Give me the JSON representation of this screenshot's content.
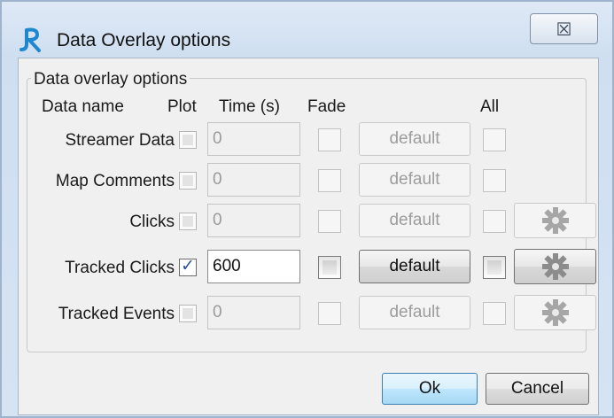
{
  "window": {
    "title": "Data Overlay options",
    "close_symbol": "☒",
    "app_icon": "app-logo-icon"
  },
  "group": {
    "label": "Data overlay options"
  },
  "headers": {
    "data_name": "Data name",
    "plot": "Plot",
    "time": "Time (s)",
    "fade": "Fade",
    "all": "All"
  },
  "rows": [
    {
      "name": "Streamer Data",
      "plot_checked": false,
      "enabled": false,
      "time": "0",
      "fade_checked": false,
      "default_label": "default",
      "all_checked": false,
      "has_settings": false
    },
    {
      "name": "Map Comments",
      "plot_checked": false,
      "enabled": false,
      "time": "0",
      "fade_checked": false,
      "default_label": "default",
      "all_checked": false,
      "has_settings": false
    },
    {
      "name": "Clicks",
      "plot_checked": false,
      "enabled": false,
      "time": "0",
      "fade_checked": false,
      "default_label": "default",
      "all_checked": false,
      "has_settings": true
    },
    {
      "name": "Tracked Clicks",
      "plot_checked": true,
      "enabled": true,
      "time": "600",
      "fade_checked": false,
      "default_label": "default",
      "all_checked": false,
      "has_settings": true
    },
    {
      "name": "Tracked Events",
      "plot_checked": false,
      "enabled": false,
      "time": "0",
      "fade_checked": false,
      "default_label": "default",
      "all_checked": false,
      "has_settings": true
    }
  ],
  "footer": {
    "ok_label": "Ok",
    "cancel_label": "Cancel"
  },
  "icons": {
    "settings": "gear-icon",
    "checkmark": "✓"
  },
  "colors": {
    "accent_blue": "#3c7fb1",
    "check_blue": "#2a4fa8",
    "disabled_text": "#9a9a9a"
  }
}
